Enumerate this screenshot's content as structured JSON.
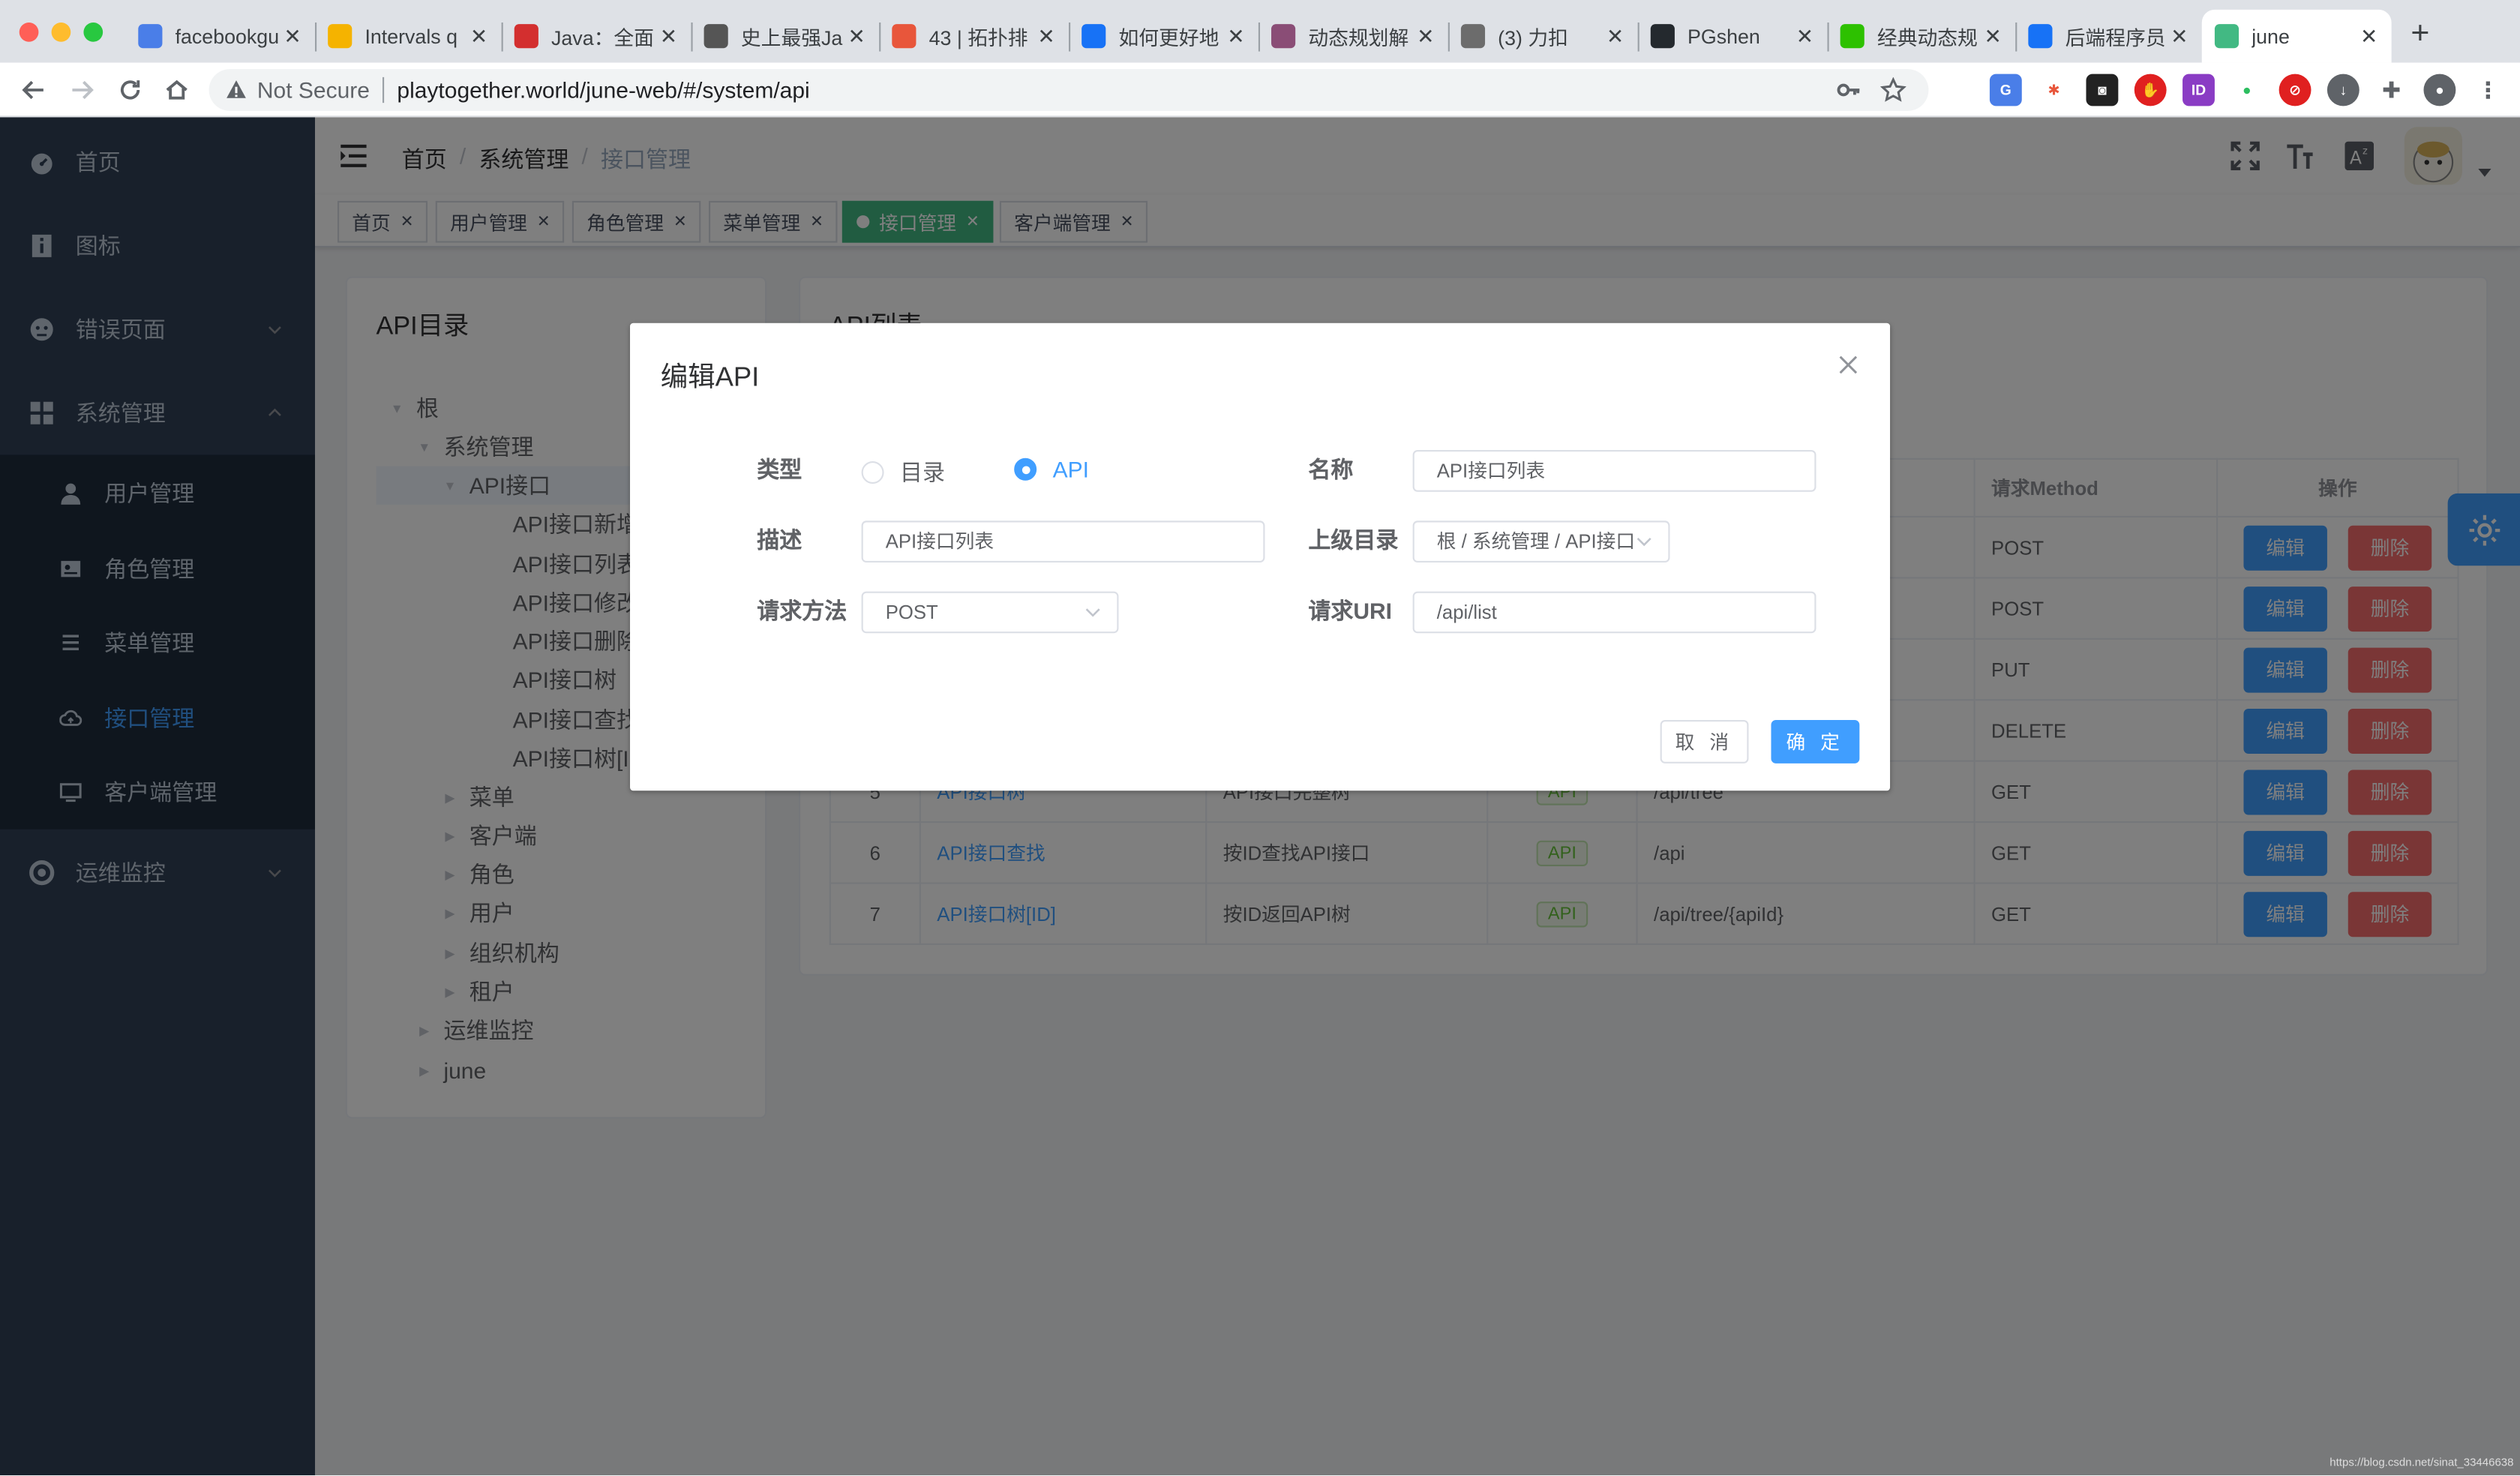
{
  "browser": {
    "tabs": [
      {
        "title": "facebookgu",
        "fav_color": "#4a7ee8"
      },
      {
        "title": "Intervals q",
        "fav_color": "#f5b300"
      },
      {
        "title": "Java：全面",
        "fav_color": "#d32f2f"
      },
      {
        "title": "史上最强Ja",
        "fav_color": "#555555"
      },
      {
        "title": "43 | 拓扑排",
        "fav_color": "#e8563b"
      },
      {
        "title": "如何更好地",
        "fav_color": "#1772f6"
      },
      {
        "title": "动态规划解",
        "fav_color": "#8a4d76"
      },
      {
        "title": "(3) 力扣",
        "fav_color": "#6c6c6c"
      },
      {
        "title": "PGshen",
        "fav_color": "#24292e"
      },
      {
        "title": "经典动态规",
        "fav_color": "#2dc100"
      },
      {
        "title": "后端程序员",
        "fav_color": "#1772f6"
      },
      {
        "title": "june",
        "fav_color": "#42b983"
      }
    ],
    "address": {
      "security": "Not Secure",
      "url": "playtogether.world/june-web/#/system/api"
    }
  },
  "sidebar": {
    "items": [
      {
        "label": "首页",
        "icon": "dashboard-icon"
      },
      {
        "label": "图标",
        "icon": "icon-icon"
      },
      {
        "label": "错误页面",
        "icon": "404-icon"
      },
      {
        "label": "系统管理",
        "icon": "component-icon"
      },
      {
        "label": "运维监控",
        "icon": "monitor-icon"
      }
    ],
    "sub_items": [
      {
        "label": "用户管理",
        "icon": "user-icon"
      },
      {
        "label": "角色管理",
        "icon": "role-icon"
      },
      {
        "label": "菜单管理",
        "icon": "menu-icon"
      },
      {
        "label": "接口管理",
        "icon": "api-icon"
      },
      {
        "label": "客户端管理",
        "icon": "client-icon"
      }
    ]
  },
  "breadcrumb": [
    "首页",
    "系统管理",
    "接口管理"
  ],
  "tags": [
    "首页",
    "用户管理",
    "角色管理",
    "菜单管理",
    "接口管理",
    "客户端管理"
  ],
  "tree": {
    "title": "API目录",
    "nodes": [
      {
        "label": "根",
        "toggle": "▼"
      },
      {
        "label": "系统管理",
        "toggle": "▼"
      },
      {
        "label": "API接口",
        "toggle": "▼"
      },
      {
        "label": "API接口新增",
        "toggle": ""
      },
      {
        "label": "API接口列表",
        "toggle": ""
      },
      {
        "label": "API接口修改",
        "toggle": ""
      },
      {
        "label": "API接口删除",
        "toggle": ""
      },
      {
        "label": "API接口树",
        "toggle": ""
      },
      {
        "label": "API接口查找",
        "toggle": ""
      },
      {
        "label": "API接口树[ID]",
        "toggle": ""
      },
      {
        "label": "菜单",
        "toggle": "▶"
      },
      {
        "label": "客户端",
        "toggle": "▶"
      },
      {
        "label": "角色",
        "toggle": "▶"
      },
      {
        "label": "用户",
        "toggle": "▶"
      },
      {
        "label": "组织机构",
        "toggle": "▶"
      },
      {
        "label": "租户",
        "toggle": "▶"
      },
      {
        "label": "运维监控",
        "toggle": "▶"
      },
      {
        "label": "june",
        "toggle": "▶"
      }
    ]
  },
  "list": {
    "title": "API列表",
    "columns": {
      "method": "请求Method",
      "ops": "操作"
    },
    "edit_label": "编辑",
    "delete_label": "删除",
    "rows": [
      {
        "idx": "",
        "name": "",
        "desc": "",
        "type": "",
        "uri": "",
        "method": "POST"
      },
      {
        "idx": "",
        "name": "",
        "desc": "",
        "type": "",
        "uri": "",
        "method": "POST"
      },
      {
        "idx": "",
        "name": "",
        "desc": "",
        "type": "",
        "uri": "",
        "method": "PUT"
      },
      {
        "idx": "",
        "name": "",
        "desc": "",
        "type": "",
        "uri": "",
        "method": "DELETE"
      },
      {
        "idx": "5",
        "name": "API接口树",
        "desc": "API接口完整树",
        "type": "API",
        "uri": "/api/tree",
        "method": "GET"
      },
      {
        "idx": "6",
        "name": "API接口查找",
        "desc": "按ID查找API接口",
        "type": "API",
        "uri": "/api",
        "method": "GET"
      },
      {
        "idx": "7",
        "name": "API接口树[ID]",
        "desc": "按ID返回API树",
        "type": "API",
        "uri": "/api/tree/{apiId}",
        "method": "GET"
      }
    ]
  },
  "dialog": {
    "title": "编辑API",
    "type_label": "类型",
    "type_options": [
      "目录",
      "API"
    ],
    "type_selected": "API",
    "name_label": "名称",
    "name_value": "API接口列表",
    "desc_label": "描述",
    "desc_value": "API接口列表",
    "parent_label": "上级目录",
    "parent_value": "根 / 系统管理 / API接口",
    "method_label": "请求方法",
    "method_value": "POST",
    "uri_label": "请求URI",
    "uri_value": "/api/list",
    "cancel_label": "取 消",
    "ok_label": "确 定"
  },
  "watermark": "https://blog.csdn.net/sinat_33446638"
}
